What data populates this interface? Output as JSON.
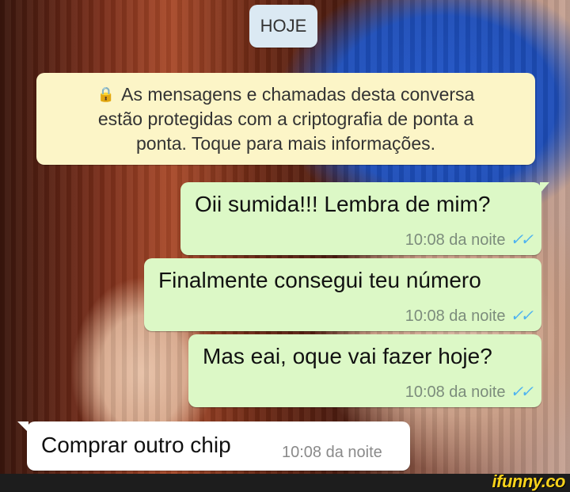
{
  "date_badge": "HOJE",
  "encryption_notice": {
    "icon": "lock-icon",
    "lines": [
      "As mensagens e chamadas desta conversa",
      "estão protegidas com a criptografia de ponta a",
      "ponta. Toque para mais informações."
    ]
  },
  "messages": [
    {
      "direction": "outgoing",
      "text": "Oii sumida!!! Lembra de mim?",
      "time": "10:08 da noite",
      "status": "read-ticks"
    },
    {
      "direction": "outgoing",
      "text": "Finalmente consegui teu número",
      "time": "10:08 da noite",
      "status": "read-ticks"
    },
    {
      "direction": "outgoing",
      "text": "Mas eai, oque vai fazer hoje?",
      "time": "10:08 da noite",
      "status": "read-ticks"
    },
    {
      "direction": "incoming",
      "text": "Comprar outro chip",
      "time": "10:08 da noite"
    }
  ],
  "watermark": "ifunny.co",
  "colors": {
    "outgoing_bubble": "#dcf8c6",
    "incoming_bubble": "#ffffff",
    "notice_bg": "#fcf5c7",
    "read_ticks": "#4fb3f0",
    "watermark": "#f7d21b"
  }
}
